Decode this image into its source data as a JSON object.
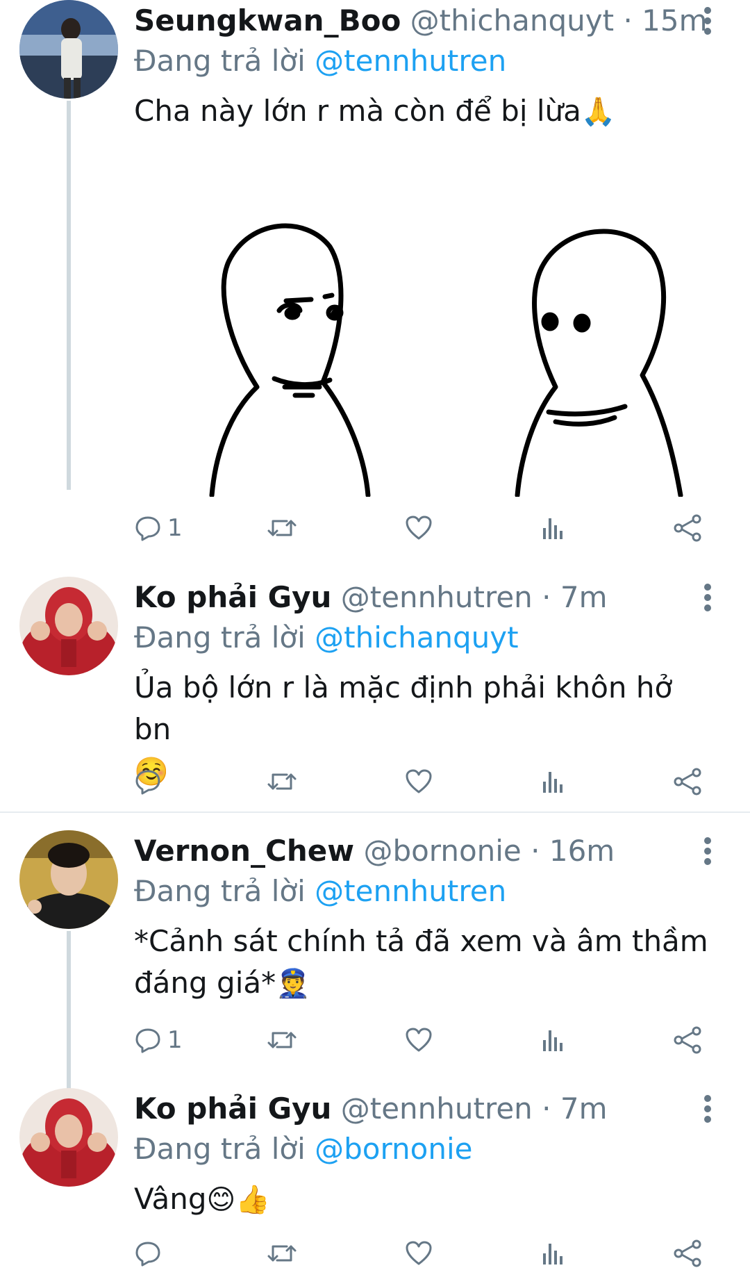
{
  "tweets": [
    {
      "name": "Seungkwan_Boo",
      "handle": "@thichanquyt",
      "dot": "·",
      "time": "15m",
      "reply_prefix": "Đang trả lời",
      "reply_to": "@tennhutren",
      "text": "Cha này lớn r mà còn để bị lừa",
      "emoji": "🙏",
      "reply_count": "1",
      "avatar": "beach-portrait"
    },
    {
      "name": "Ko phải Gyu",
      "handle": "@tennhutren",
      "dot": "·",
      "time": "7m",
      "reply_prefix": "Đang trả lời",
      "reply_to": "@thichanquyt",
      "text": "Ủa bộ lớn r là mặc định phải khôn hở bn",
      "emoji": "☺️",
      "reply_count": "",
      "avatar": "red-hoodie"
    },
    {
      "name": "Vernon_Chew",
      "handle": "@bornonie",
      "dot": "·",
      "time": "16m",
      "reply_prefix": "Đang trả lời",
      "reply_to": "@tennhutren",
      "text": "*Cảnh sát chính tả đã xem và âm thầm đáng giá*",
      "emoji": "👮",
      "reply_count": "1",
      "avatar": "dark-portrait"
    },
    {
      "name": "Ko phải Gyu",
      "handle": "@tennhutren",
      "dot": "·",
      "time": "7m",
      "reply_prefix": "Đang trả lời",
      "reply_to": "@bornonie",
      "text": "Vâng",
      "emoji": "😊👍",
      "reply_count": "",
      "avatar": "red-hoodie"
    }
  ],
  "icons": {
    "reply": "reply-icon",
    "retweet": "retweet-icon",
    "like": "heart-icon",
    "analytics": "analytics-icon",
    "share": "share-icon",
    "more": "more-vertical-icon"
  },
  "colors": {
    "link": "#1da1f2",
    "muted": "#657786",
    "text": "#14171a",
    "thread_line": "#cfd9de"
  }
}
